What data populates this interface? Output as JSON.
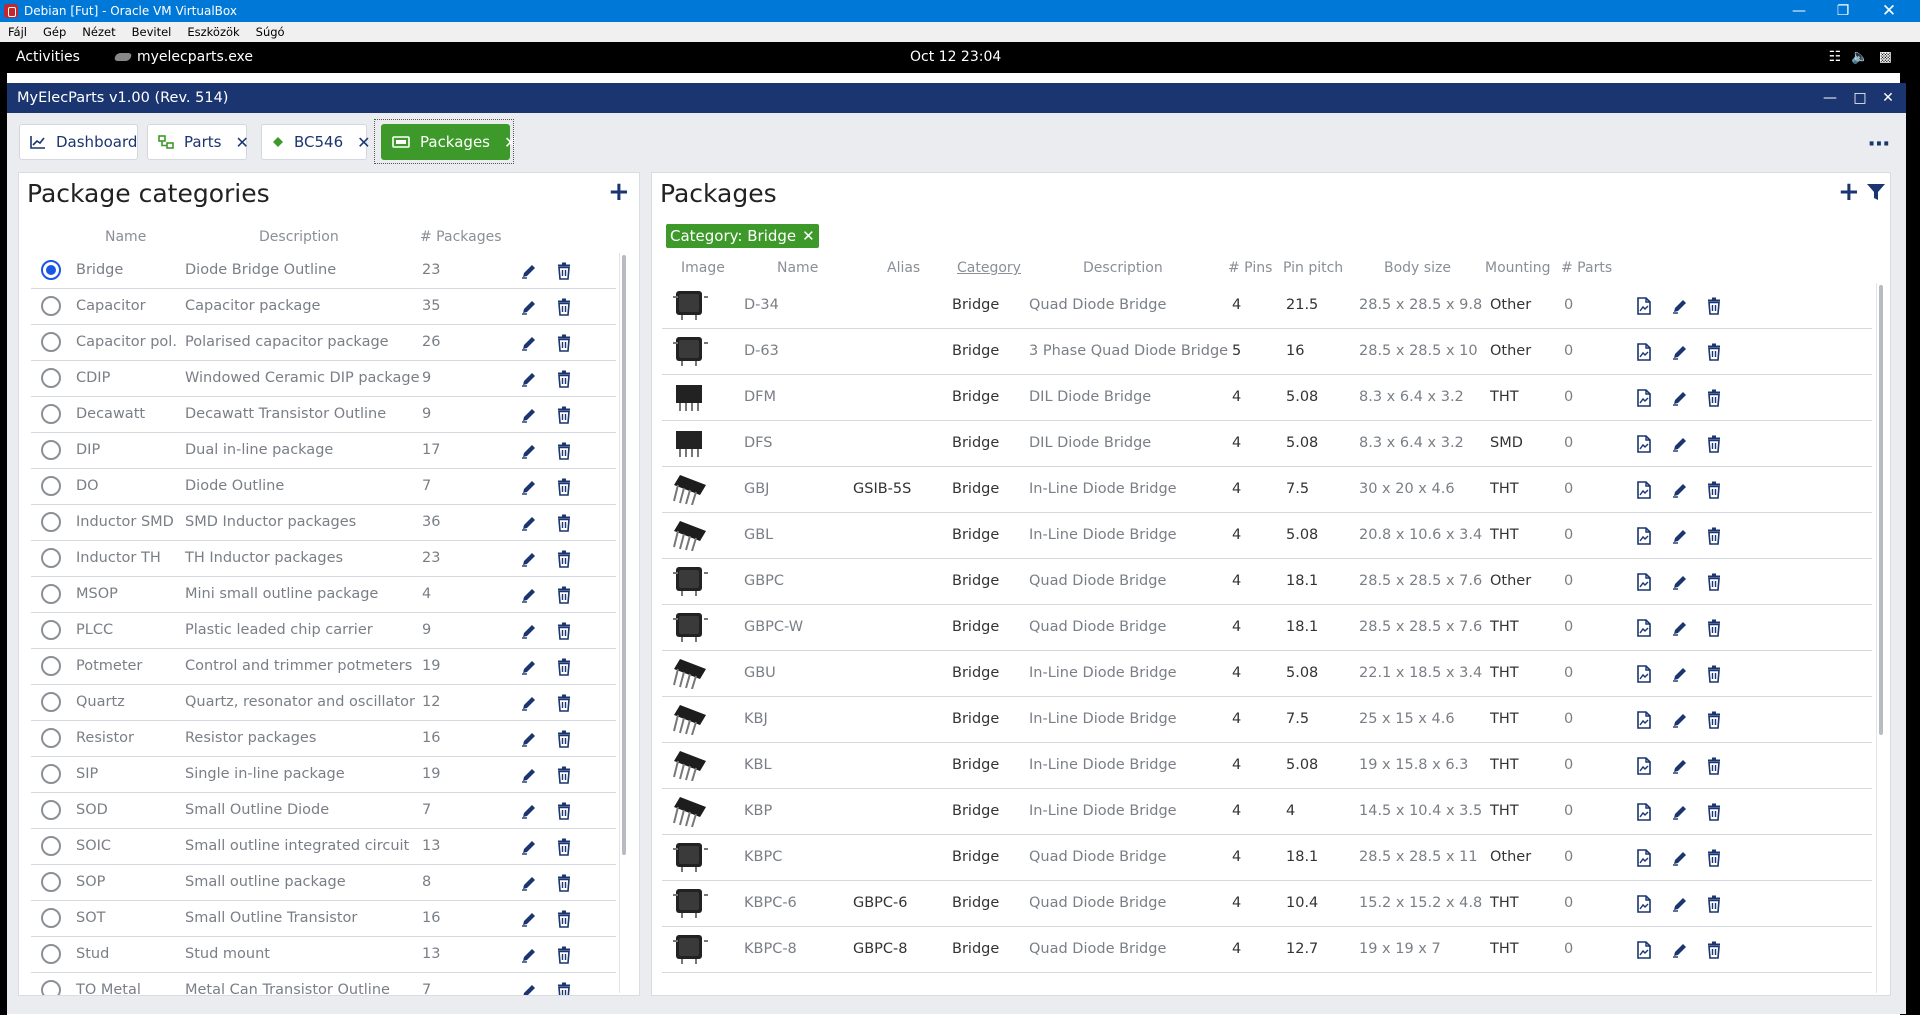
{
  "vbox": {
    "title": "Debian [Fut] - Oracle VM VirtualBox",
    "menu": [
      "Fájl",
      "Gép",
      "Nézet",
      "Bevitel",
      "Eszközök",
      "Súgó"
    ]
  },
  "gnome": {
    "activities": "Activities",
    "app": "myelecparts.exe",
    "clock": "Oct 12  23:04"
  },
  "app": {
    "title": "MyElecParts v1.00  (Rev. 514)"
  },
  "tabs": [
    {
      "label": "Dashboard",
      "closable": false
    },
    {
      "label": "Parts",
      "closable": true
    },
    {
      "label": "BC546",
      "closable": true
    },
    {
      "label": "Packages",
      "closable": true,
      "active": true
    }
  ],
  "left": {
    "title": "Package categories",
    "headers": {
      "name": "Name",
      "description": "Description",
      "count": "# Packages"
    },
    "rows": [
      {
        "name": "Bridge",
        "desc": "Diode Bridge Outline",
        "count": "23",
        "selected": true
      },
      {
        "name": "Capacitor",
        "desc": "Capacitor package",
        "count": "35"
      },
      {
        "name": "Capacitor pol.",
        "desc": "Polarised capacitor package",
        "count": "26"
      },
      {
        "name": "CDIP",
        "desc": "Windowed Ceramic DIP package",
        "count": "9"
      },
      {
        "name": "Decawatt",
        "desc": "Decawatt Transistor Outline",
        "count": "9"
      },
      {
        "name": "DIP",
        "desc": "Dual in-line package",
        "count": "17"
      },
      {
        "name": "DO",
        "desc": "Diode Outline",
        "count": "7"
      },
      {
        "name": "Inductor SMD",
        "desc": "SMD Inductor packages",
        "count": "36"
      },
      {
        "name": "Inductor TH",
        "desc": "TH Inductor packages",
        "count": "23"
      },
      {
        "name": "MSOP",
        "desc": "Mini small outline package",
        "count": "4"
      },
      {
        "name": "PLCC",
        "desc": "Plastic leaded chip carrier",
        "count": "9"
      },
      {
        "name": "Potmeter",
        "desc": "Control and trimmer potmeters",
        "count": "19"
      },
      {
        "name": "Quartz",
        "desc": "Quartz, resonator and oscillator",
        "count": "12"
      },
      {
        "name": "Resistor",
        "desc": "Resistor packages",
        "count": "16"
      },
      {
        "name": "SIP",
        "desc": "Single in-line package",
        "count": "19"
      },
      {
        "name": "SOD",
        "desc": "Small Outline Diode",
        "count": "7"
      },
      {
        "name": "SOIC",
        "desc": "Small outline integrated circuit",
        "count": "13"
      },
      {
        "name": "SOP",
        "desc": "Small outline package",
        "count": "8"
      },
      {
        "name": "SOT",
        "desc": "Small Outline Transistor",
        "count": "16"
      },
      {
        "name": "Stud",
        "desc": "Stud mount",
        "count": "13"
      },
      {
        "name": "TO Metal",
        "desc": "Metal Can Transistor Outline",
        "count": "7"
      }
    ]
  },
  "right": {
    "title": "Packages",
    "filter_chip": "Category: Bridge",
    "headers": {
      "image": "Image",
      "name": "Name",
      "alias": "Alias",
      "category": "Category",
      "description": "Description",
      "pins": "# Pins",
      "pitch": "Pin pitch",
      "body": "Body size",
      "mounting": "Mounting",
      "parts": "# Parts"
    },
    "rows": [
      {
        "name": "D-34",
        "alias": "",
        "cat": "Bridge",
        "desc": "Quad Diode Bridge",
        "pins": "4",
        "pitch": "21.5",
        "body": "28.5 x 28.5 x 9.8",
        "mount": "Other",
        "parts": "0",
        "img": "square"
      },
      {
        "name": "D-63",
        "alias": "",
        "cat": "Bridge",
        "desc": "3 Phase Quad Diode Bridge",
        "pins": "5",
        "pitch": "16",
        "body": "28.5 x 28.5 x 10",
        "mount": "Other",
        "parts": "0",
        "img": "square"
      },
      {
        "name": "DFM",
        "alias": "",
        "cat": "Bridge",
        "desc": "DIL Diode Bridge",
        "pins": "4",
        "pitch": "5.08",
        "body": "8.3 x 6.4 x 3.2",
        "mount": "THT",
        "parts": "0",
        "img": "dil"
      },
      {
        "name": "DFS",
        "alias": "",
        "cat": "Bridge",
        "desc": "DIL Diode Bridge",
        "pins": "4",
        "pitch": "5.08",
        "body": "8.3 x 6.4 x 3.2",
        "mount": "SMD",
        "parts": "0",
        "img": "dil"
      },
      {
        "name": "GBJ",
        "alias": "GSIB-5S",
        "cat": "Bridge",
        "desc": "In-Line Diode Bridge",
        "pins": "4",
        "pitch": "7.5",
        "body": "30 x 20 x 4.6",
        "mount": "THT",
        "parts": "0",
        "img": "inline"
      },
      {
        "name": "GBL",
        "alias": "",
        "cat": "Bridge",
        "desc": "In-Line Diode Bridge",
        "pins": "4",
        "pitch": "5.08",
        "body": "20.8 x 10.6 x 3.4",
        "mount": "THT",
        "parts": "0",
        "img": "inline"
      },
      {
        "name": "GBPC",
        "alias": "",
        "cat": "Bridge",
        "desc": "Quad Diode Bridge",
        "pins": "4",
        "pitch": "18.1",
        "body": "28.5 x 28.5 x 7.6",
        "mount": "Other",
        "parts": "0",
        "img": "square"
      },
      {
        "name": "GBPC-W",
        "alias": "",
        "cat": "Bridge",
        "desc": "Quad Diode Bridge",
        "pins": "4",
        "pitch": "18.1",
        "body": "28.5 x 28.5 x 7.6",
        "mount": "THT",
        "parts": "0",
        "img": "square"
      },
      {
        "name": "GBU",
        "alias": "",
        "cat": "Bridge",
        "desc": "In-Line Diode Bridge",
        "pins": "4",
        "pitch": "5.08",
        "body": "22.1 x 18.5 x 3.4",
        "mount": "THT",
        "parts": "0",
        "img": "inline"
      },
      {
        "name": "KBJ",
        "alias": "",
        "cat": "Bridge",
        "desc": "In-Line Diode Bridge",
        "pins": "4",
        "pitch": "7.5",
        "body": "25 x 15 x 4.6",
        "mount": "THT",
        "parts": "0",
        "img": "inline"
      },
      {
        "name": "KBL",
        "alias": "",
        "cat": "Bridge",
        "desc": "In-Line Diode Bridge",
        "pins": "4",
        "pitch": "5.08",
        "body": "19 x 15.8 x 6.3",
        "mount": "THT",
        "parts": "0",
        "img": "inline"
      },
      {
        "name": "KBP",
        "alias": "",
        "cat": "Bridge",
        "desc": "In-Line Diode Bridge",
        "pins": "4",
        "pitch": "4",
        "body": "14.5 x 10.4 x 3.5",
        "mount": "THT",
        "parts": "0",
        "img": "inline"
      },
      {
        "name": "KBPC",
        "alias": "",
        "cat": "Bridge",
        "desc": "Quad Diode Bridge",
        "pins": "4",
        "pitch": "18.1",
        "body": "28.5 x 28.5 x 11",
        "mount": "Other",
        "parts": "0",
        "img": "square"
      },
      {
        "name": "KBPC-6",
        "alias": "GBPC-6",
        "cat": "Bridge",
        "desc": "Quad Diode Bridge",
        "pins": "4",
        "pitch": "10.4",
        "body": "15.2 x 15.2 x 4.8",
        "mount": "THT",
        "parts": "0",
        "img": "square"
      },
      {
        "name": "KBPC-8",
        "alias": "GBPC-8",
        "cat": "Bridge",
        "desc": "Quad Diode Bridge",
        "pins": "4",
        "pitch": "12.7",
        "body": "19 x 19 x 7",
        "mount": "THT",
        "parts": "0",
        "img": "square"
      }
    ]
  },
  "colors": {
    "accent": "#1a3570",
    "active_tab": "#3d9a2a",
    "radio_on": "#1a56e6"
  }
}
